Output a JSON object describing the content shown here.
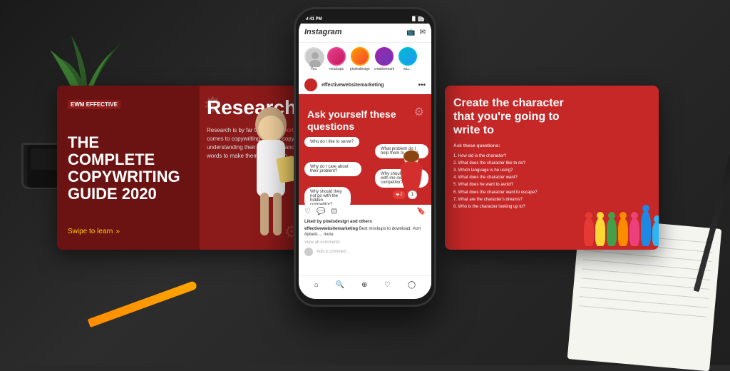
{
  "background": {
    "color": "#2a2a2a"
  },
  "banner_card": {
    "logo": "EWM EFFECTIVE",
    "title": "THE COMPLETE COPYWRITING GUIDE 2020",
    "research_label": "Research",
    "swipe_label": "Swipe to learn",
    "description": "Research is by far the most important part when it comes to copywriting. A good copywriter is understanding their customers and is using their own words to make them take action.",
    "highlight_word": "most important"
  },
  "phone": {
    "status_time": "9:41 PM",
    "status_icons": "▐▌▌ ▓▓▓",
    "instagram_logo": "Instagram",
    "stories": [
      {
        "label": "You",
        "class": "you"
      },
      {
        "label": "mockups",
        "class": "s1"
      },
      {
        "label": "pixelsdesign",
        "class": "s2"
      },
      {
        "label": "creativemarket",
        "class": "s3"
      },
      {
        "label": "stu...",
        "class": "s4"
      }
    ],
    "post_username": "effectivewebsitemarketing",
    "post_title": "Ask yourself these questions",
    "gear_icon": "⚙",
    "bubbles": [
      {
        "text": "Who do I like to serve?",
        "pos": "bubble1"
      },
      {
        "text": "What problem do I help them to solve?",
        "pos": "bubble2"
      },
      {
        "text": "Why do I care about their problem?",
        "pos": "bubble3"
      },
      {
        "text": "Why should they go with me instead of a competitor?",
        "pos": "bubble4"
      },
      {
        "text": "Why should they not go with the hidden competitor?",
        "pos": "bubble5"
      }
    ],
    "likes_text": "Liked by pixelsdesign and others",
    "caption": "Best mockups to download. #crn #pixels ... more",
    "view_comments": "View all comments",
    "add_comment": "Add a comment...",
    "like_count": "2",
    "comment_count": "1",
    "nav_icons": [
      "🏠",
      "🔍",
      "➕",
      "❤️",
      "👤"
    ]
  },
  "right_card": {
    "title": "Create the character that you're going to write to",
    "subtitle": "Ask these questions:",
    "questions": [
      "1. How old is the character?",
      "2. What does the character like to do?",
      "3. Which language is he using?",
      "4. What does the character want?",
      "5. What does he want to avoid?",
      "6. What does the character want to escape?",
      "7. What are the character's dreams?",
      "8. Who is the character looking up to?"
    ],
    "figures": [
      {
        "color": "#e53935",
        "class": "fig-red"
      },
      {
        "color": "#fdd835",
        "class": "fig-yellow"
      },
      {
        "color": "#43a047",
        "class": "fig-green"
      },
      {
        "color": "#fb8c00",
        "class": "fig-orange"
      },
      {
        "color": "#ec407a",
        "class": "fig-pink"
      },
      {
        "color": "#1e88e5",
        "class": "fig-blue"
      },
      {
        "color": "#29b6f6",
        "class": "fig-lightblue"
      }
    ]
  }
}
